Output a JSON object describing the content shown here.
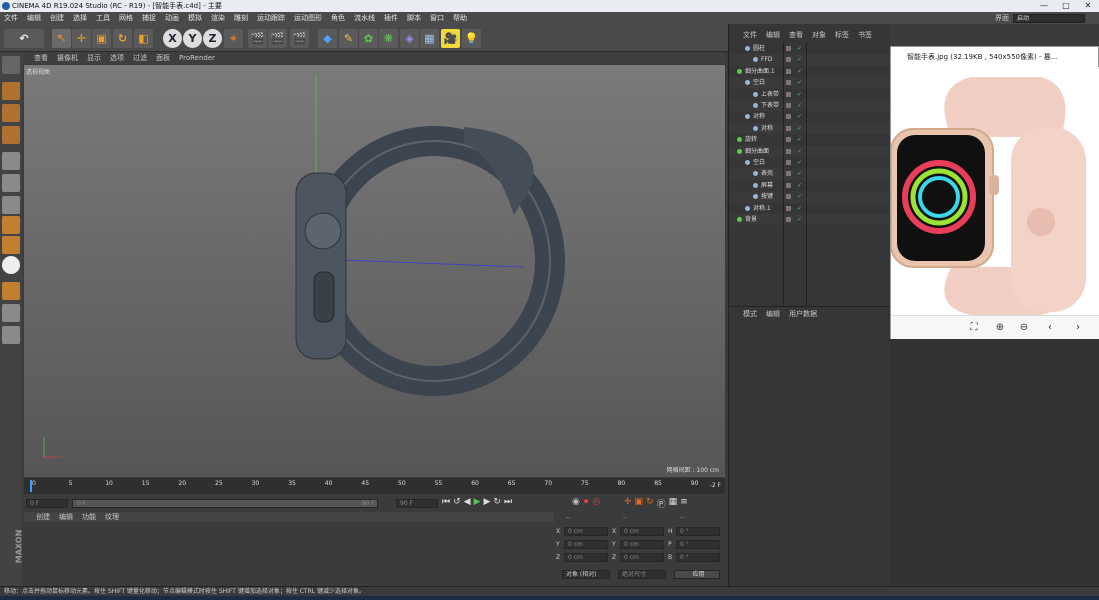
{
  "window": {
    "title": "CINEMA 4D R19.024 Studio (RC - R19) - [智能手表.c4d] - 主要"
  },
  "menubar": {
    "items": [
      "文件",
      "编辑",
      "创建",
      "选择",
      "工具",
      "网格",
      "捕捉",
      "动画",
      "模拟",
      "渲染",
      "雕刻",
      "运动跟踪",
      "运动图形",
      "角色",
      "流水线",
      "插件",
      "脚本",
      "窗口",
      "帮助"
    ]
  },
  "layout": {
    "label": "界面",
    "value": "启动"
  },
  "viewport": {
    "menu": [
      "查看",
      "摄像机",
      "显示",
      "选项",
      "过滤",
      "面板",
      "ProRender"
    ],
    "label": "透视视图",
    "grid_spacing": "网格间距 : 100 cm"
  },
  "timeline": {
    "ticks": [
      "0",
      "5",
      "10",
      "15",
      "20",
      "25",
      "30",
      "35",
      "40",
      "45",
      "50",
      "55",
      "60",
      "65",
      "70",
      "75",
      "80",
      "85",
      "90"
    ],
    "end_frame": "-2 F",
    "start_field": "0 F",
    "range_start": "0 F",
    "range_end": "90 F",
    "end_field": "90 F"
  },
  "material": {
    "menu": [
      "创建",
      "编辑",
      "功能",
      "纹理"
    ]
  },
  "coords": {
    "header": [
      "--",
      "--",
      "--"
    ],
    "rows": [
      {
        "a": "X",
        "av": "0 cm",
        "b": "X",
        "bv": "0 cm",
        "c": "H",
        "cv": "0 °"
      },
      {
        "a": "Y",
        "av": "0 cm",
        "b": "Y",
        "bv": "0 cm",
        "c": "P",
        "cv": "0 °"
      },
      {
        "a": "Z",
        "av": "0 cm",
        "b": "Z",
        "bv": "0 cm",
        "c": "B",
        "cv": "0 °"
      }
    ],
    "mode": "对象 (相对)",
    "size_mode": "绝对尺寸",
    "apply": "应用"
  },
  "objects": {
    "menu": [
      "文件",
      "编辑",
      "查看",
      "对象",
      "标签",
      "书签"
    ],
    "items": [
      {
        "label": "圆柱",
        "indent": 1
      },
      {
        "label": "FFD",
        "indent": 2
      },
      {
        "label": "细分曲面.1",
        "indent": 0
      },
      {
        "label": "空白",
        "indent": 1
      },
      {
        "label": "上表带",
        "indent": 2
      },
      {
        "label": "下表带",
        "indent": 2
      },
      {
        "label": "对称",
        "indent": 1
      },
      {
        "label": "对称",
        "indent": 2
      },
      {
        "label": "旋转",
        "indent": 0
      },
      {
        "label": "细分曲面",
        "indent": 0
      },
      {
        "label": "空白",
        "indent": 1
      },
      {
        "label": "表壳",
        "indent": 2
      },
      {
        "label": "屏幕",
        "indent": 2
      },
      {
        "label": "按键",
        "indent": 2
      },
      {
        "label": "对称.1",
        "indent": 1
      },
      {
        "label": "背景",
        "indent": 0
      }
    ]
  },
  "attributes": {
    "menu": [
      "模式",
      "编辑",
      "用户数据"
    ]
  },
  "viewer": {
    "title": "智能手表.jpg (32.19KB , 540x550像素) - 篡..."
  },
  "branding": {
    "maxon": "MAXON",
    "product": "CINEMA 4D"
  },
  "status": {
    "text": "移动：点击并拖动鼠标移动元素。按住 SHIFT 键量化移动；节点编辑模式时按住 SHIFT 键增加选择对象；按住 CTRL 键减少选择对象。"
  }
}
